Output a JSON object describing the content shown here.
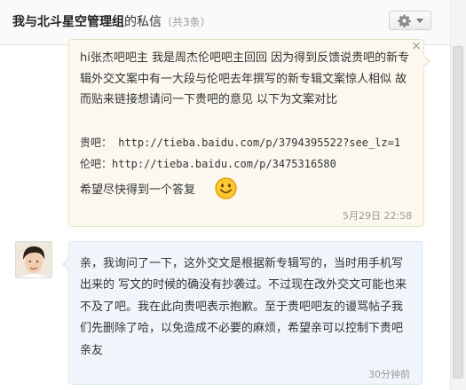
{
  "header": {
    "conversation_name": "我与北斗星空管理组",
    "title_suffix": "的私信",
    "message_count": "（共3条）",
    "settings_icon": "gear-icon",
    "settings_caret_icon": "caret-down-icon"
  },
  "messages": [
    {
      "direction": "sent",
      "close_label": "×",
      "text": "hi张杰吧吧主 我是周杰伦吧吧主回回 因为得到反馈说贵吧的新专辑外交文案中有一大段与伦吧去年撰写的新专辑文案惊人相似 故而贴来链接想请问一下贵吧的意见 以下为文案对比",
      "link1": "贵吧： http://tieba.baidu.com/p/3794395522?see_lz=1",
      "link2": "伦吧：http://tieba.baidu.com/p/3475316580",
      "closing": "希望尽快得到一个答复",
      "emoji": "smiley-face-emoji",
      "time": "5月29日 22:58"
    },
    {
      "direction": "received",
      "text": "亲，我询问了一下，这外交文是根据新专辑写的，当时用手机写出来的 写文的时候的确没有抄袭过。不过现在改外交文可能也来不及了吧。我在此向贵吧表示抱歉。至于贵吧吧友的谩骂帖子我们先删除了哈，以免造成不必要的麻烦，希望亲可以控制下贵吧亲友",
      "time": "30分钟前"
    }
  ],
  "colors": {
    "sent_bubble_bg": "#fbf9ef",
    "received_bubble_bg": "#f0f6fb",
    "muted_text": "#999999"
  }
}
